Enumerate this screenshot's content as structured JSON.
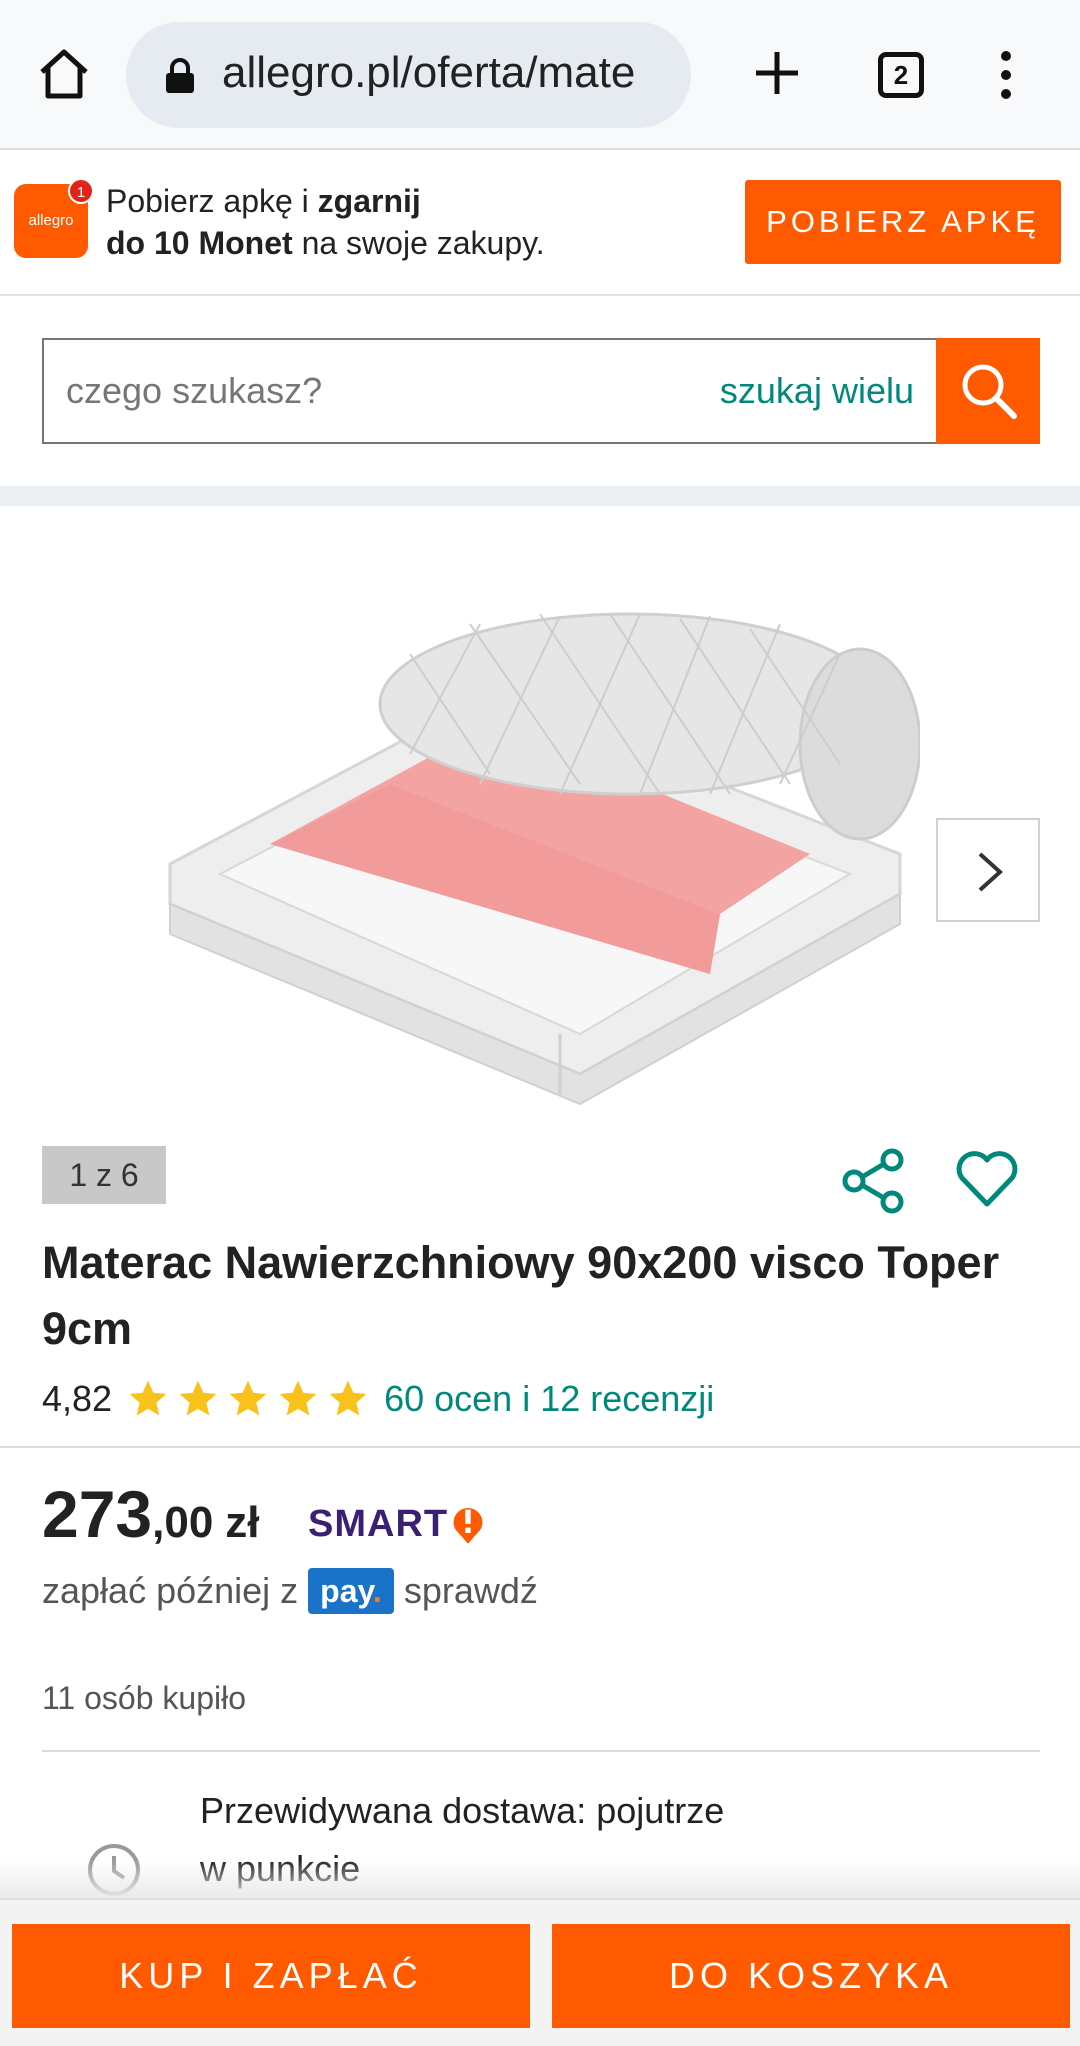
{
  "browser": {
    "url": "allegro.pl/oferta/mate",
    "tab_count": "2",
    "icons": [
      "home-icon",
      "lock-icon",
      "new-tab-icon",
      "tabs-icon",
      "more-icon"
    ]
  },
  "app_banner": {
    "logo_text": "allegro",
    "notification_count": "1",
    "line1_prefix": "Pobierz apkę i ",
    "line1_bold": "zgarnij",
    "line2_bold": "do 10 Monet",
    "line2_suffix": " na swoje zakupy.",
    "cta_label": "POBIERZ APKĘ"
  },
  "search": {
    "placeholder": "czego szukasz?",
    "multi_search_label": "szukaj wielu"
  },
  "gallery": {
    "counter": "1 z 6"
  },
  "product": {
    "title": "Materac Nawierzchniowy 90x200 visco Toper 9cm",
    "rating_value": "4,82",
    "stars_count": 5,
    "reviews_text": "60 ocen i 12 recenzji",
    "price_int": "273",
    "price_dec": ",00",
    "currency": "zł",
    "smart_label": "SMART",
    "pay_later_prefix": "zapłać później z",
    "pay_badge": "pay",
    "pay_badge_dot": ".",
    "pay_later_link": "sprawdź",
    "bought_text": "11 osób kupiło",
    "delivery_line1": "Przewidywana dostawa: pojutrze",
    "delivery_line2": "w punkcie"
  },
  "actions": {
    "buy_now": "KUP I ZAPŁAĆ",
    "add_to_cart": "DO KOSZYKA"
  },
  "colors": {
    "brand_orange": "#ff5a00",
    "link_teal": "#00897b",
    "star_yellow": "#f8c21a",
    "smart_purple": "#3a1f73"
  }
}
